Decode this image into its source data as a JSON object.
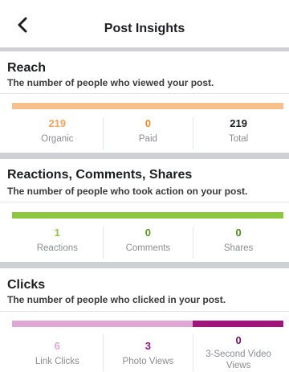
{
  "header": {
    "title": "Post Insights",
    "back_icon": "chevron-left-icon"
  },
  "sections": [
    {
      "title": "Reach",
      "description": "The number of people who viewed your post.",
      "bar": [
        {
          "share": 1.0,
          "color": "#f7c08a"
        }
      ],
      "metrics": [
        {
          "value": "219",
          "label": "Organic",
          "color": "#f7a35c"
        },
        {
          "value": "0",
          "label": "Paid",
          "color": "#f78b1d"
        },
        {
          "value": "219",
          "label": "Total",
          "color": "#1c1e21"
        }
      ]
    },
    {
      "title": "Reactions, Comments, Shares",
      "description": "The number of people who took action on your post.",
      "bar": [
        {
          "share": 1.0,
          "color": "#8dc63f"
        }
      ],
      "metrics": [
        {
          "value": "1",
          "label": "Reactions",
          "color": "#8dc63f"
        },
        {
          "value": "0",
          "label": "Comments",
          "color": "#5b9a1f"
        },
        {
          "value": "0",
          "label": "Shares",
          "color": "#4e8a1a"
        }
      ]
    },
    {
      "title": "Clicks",
      "description": "The number of people who clicked in your post.",
      "bar": [
        {
          "share": 0.667,
          "color": "#e0a6d6"
        },
        {
          "share": 0.333,
          "color": "#a3137f"
        }
      ],
      "metrics": [
        {
          "value": "6",
          "label": "Link Clicks",
          "color": "#e0a6d6"
        },
        {
          "value": "3",
          "label": "Photo Views",
          "color": "#a3137f"
        },
        {
          "value": "0",
          "label": "3-Second Video Views",
          "color": "#7a0f60"
        }
      ]
    }
  ]
}
